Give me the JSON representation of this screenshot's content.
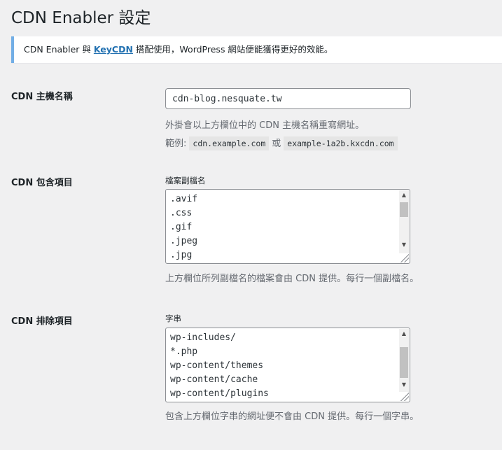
{
  "page": {
    "title": "CDN Enabler 設定"
  },
  "notice": {
    "text_before": "CDN Enabler 與 ",
    "link_text": "KeyCDN",
    "text_after": " 搭配使用，WordPress 網站便能獲得更好的效能。"
  },
  "hostname": {
    "label": "CDN 主機名稱",
    "value": "cdn-blog.nesquate.tw",
    "description": "外掛會以上方欄位中的 CDN 主機名稱重寫網址。",
    "example_prefix": "範例:",
    "example_1": "cdn.example.com",
    "example_or": "或",
    "example_2": "example-1a2b.kxcdn.com"
  },
  "inclusions": {
    "label": "CDN 包含項目",
    "field_label": "檔案副檔名",
    "lines": [
      ".avif",
      ".css",
      ".gif",
      ".jpeg",
      ".jpg"
    ],
    "description": "上方欄位所列副檔名的檔案會由 CDN 提供。每行一個副檔名。"
  },
  "exclusions": {
    "label": "CDN 排除項目",
    "field_label": "字串",
    "lines": [
      "wp-includes/",
      "*.php",
      "wp-content/themes",
      "wp-content/cache",
      "wp-content/plugins"
    ],
    "description": "包含上方欄位字串的網址便不會由 CDN 提供。每行一個字串。"
  },
  "icons": {
    "scroll_up": "scroll-up-arrow-icon",
    "scroll_down": "scroll-down-arrow-icon",
    "resize": "resize-handle-icon"
  },
  "colors": {
    "background": "#f0f0f1",
    "notice_border": "#72aee6",
    "link": "#2271b1",
    "description_text": "#646970"
  }
}
